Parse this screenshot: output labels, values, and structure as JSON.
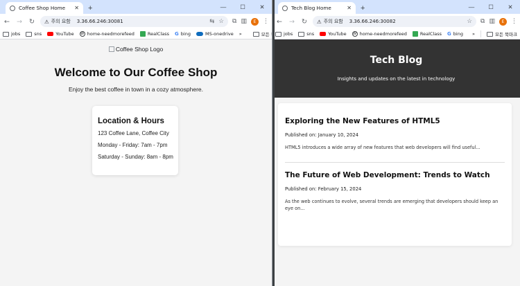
{
  "left_window": {
    "tab_title": "Coffee Shop Home",
    "security_label": "주의 요함",
    "url": "3.36.66.246:30081",
    "avatar_initial": "E",
    "bookmarks": [
      "jobs",
      "sns",
      "YouTube",
      "home-needmorefeed",
      "RealClass",
      "bing",
      "MS-onedrive"
    ],
    "bookmarks_more": "»",
    "all_bookmarks": "모든 북마크",
    "page": {
      "logo_alt": "Coffee Shop Logo",
      "heading": "Welcome to Our Coffee Shop",
      "subheading": "Enjoy the best coffee in town in a cozy atmosphere.",
      "card_title": "Location & Hours",
      "address": "123 Coffee Lane, Coffee City",
      "hours_weekday": "Monday - Friday: 7am - 7pm",
      "hours_weekend": "Saturday - Sunday: 8am - 8pm"
    }
  },
  "right_window": {
    "tab_title": "Tech Blog Home",
    "security_label": "주의 요함",
    "url": "3.36.66.246:30082",
    "avatar_initial": "E",
    "bookmarks": [
      "jobs",
      "sns",
      "YouTube",
      "home-needmorefeed",
      "RealClass",
      "bing"
    ],
    "bookmarks_more": "»",
    "all_bookmarks": "모든 북마크",
    "page": {
      "title": "Tech Blog",
      "tagline": "Insights and updates on the latest in technology",
      "posts": [
        {
          "title": "Exploring the New Features of HTML5",
          "date": "Published on: January 10, 2024",
          "excerpt": "HTML5 introduces a wide array of new features that web developers will find useful..."
        },
        {
          "title": "The Future of Web Development: Trends to Watch",
          "date": "Published on: February 15, 2024",
          "excerpt": "As the web continues to evolve, several trends are emerging that developers should keep an eye on..."
        }
      ]
    }
  },
  "colors": {
    "tabstrip": "#d3e3fd",
    "blog_header": "#333333",
    "page_bg": "#f4f4f4",
    "avatar": "#e8710a"
  }
}
